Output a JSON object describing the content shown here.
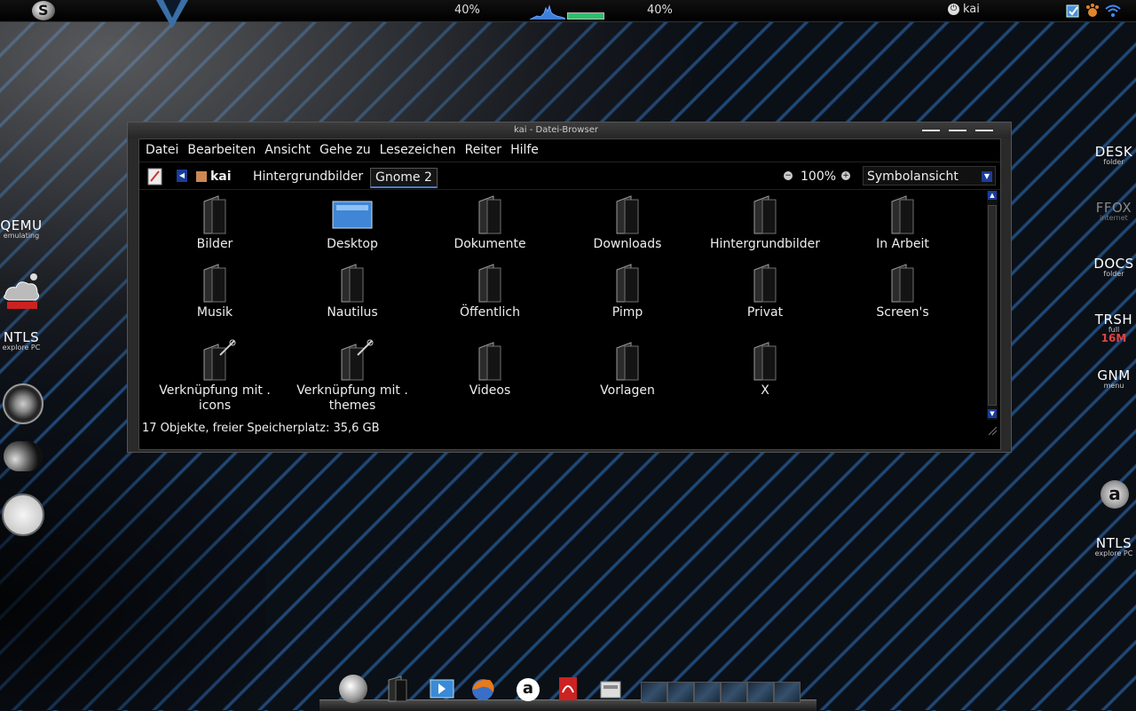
{
  "top_panel": {
    "cpu_left": "40%",
    "cpu_right": "40%",
    "user": "kai",
    "meter_fraction": 1.0
  },
  "desktop_left": {
    "qemu": {
      "title": "QEMU",
      "subtitle": "emulating"
    },
    "ntls": {
      "title": "NTLS",
      "subtitle": "explore PC"
    }
  },
  "desktop_right": {
    "desk": {
      "title": "DESK",
      "subtitle": "folder"
    },
    "ffox": {
      "title": "FFOX",
      "subtitle": "internet"
    },
    "docs": {
      "title": "DOCS",
      "subtitle": "folder"
    },
    "trsh": {
      "title": "TRSH",
      "subtitle": "full",
      "size": "16M"
    },
    "gnm": {
      "title": "GNM",
      "subtitle": "menu"
    },
    "ntls": {
      "title": "NTLS",
      "subtitle": "explore PC"
    }
  },
  "window": {
    "title": "kai - Datei-Browser",
    "menu": [
      "Datei",
      "Bearbeiten",
      "Ansicht",
      "Gehe zu",
      "Lesezeichen",
      "Reiter",
      "Hilfe"
    ],
    "breadcrumbs": {
      "home": "kai",
      "folder1": "Hintergrundbilder",
      "folder2": "Gnome 2"
    },
    "zoom": "100%",
    "view_mode": "Symbolansicht",
    "items": [
      {
        "label": "Bilder",
        "type": "folder"
      },
      {
        "label": "Desktop",
        "type": "desktop"
      },
      {
        "label": "Dokumente",
        "type": "folder"
      },
      {
        "label": "Downloads",
        "type": "folder"
      },
      {
        "label": "Hintergrundbilder",
        "type": "folder"
      },
      {
        "label": "In Arbeit",
        "type": "folder"
      },
      {
        "label": "Musik",
        "type": "folder"
      },
      {
        "label": "Nautilus",
        "type": "folder"
      },
      {
        "label": "Öffentlich",
        "type": "folder"
      },
      {
        "label": "Pimp",
        "type": "folder"
      },
      {
        "label": "Privat",
        "type": "folder"
      },
      {
        "label": "Screen's",
        "type": "folder"
      },
      {
        "label": "Verknüpfung mit . icons",
        "type": "link"
      },
      {
        "label": "Verknüpfung mit . themes",
        "type": "link"
      },
      {
        "label": "Videos",
        "type": "folder"
      },
      {
        "label": "Vorlagen",
        "type": "folder"
      },
      {
        "label": "X",
        "type": "folder"
      }
    ],
    "status": "17 Objekte, freier Speicherplatz: 35,6 GB"
  }
}
